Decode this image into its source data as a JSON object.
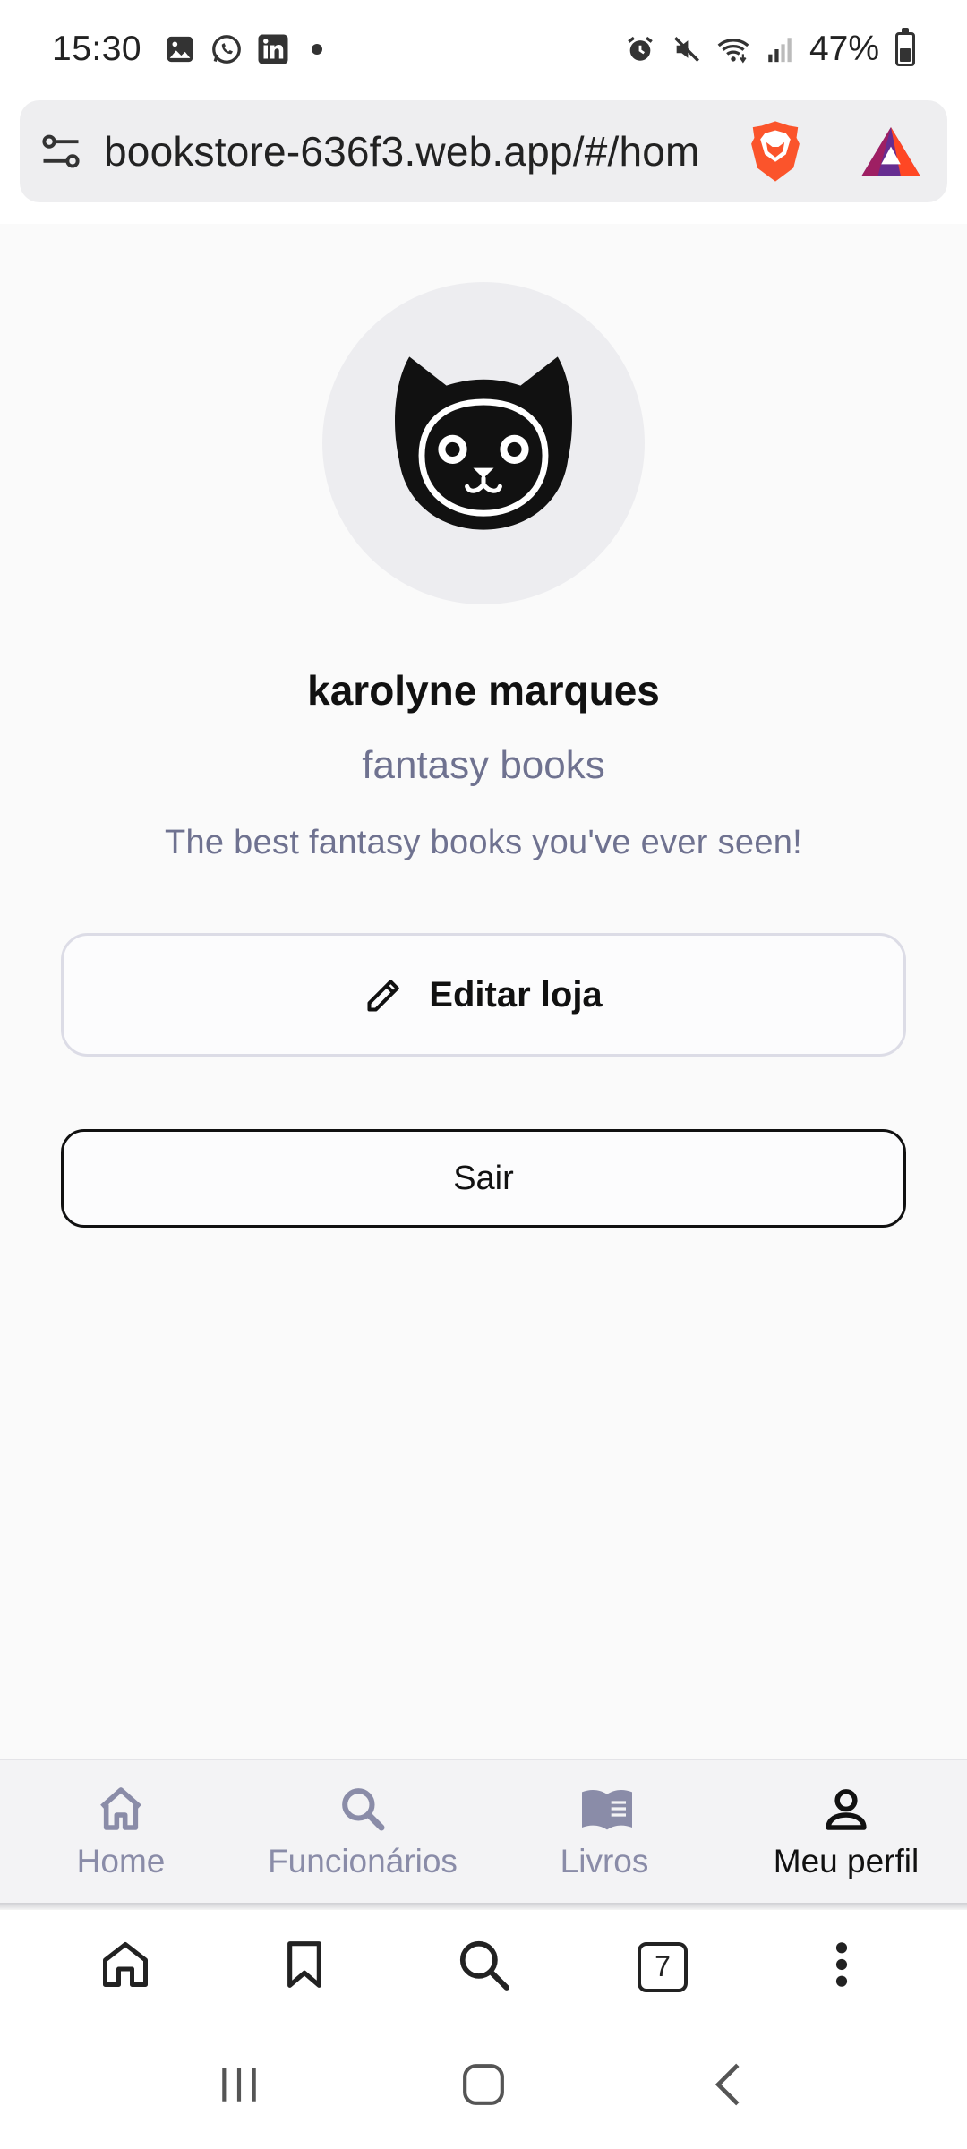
{
  "status_bar": {
    "time": "15:30",
    "battery_percent": "47%",
    "left_icons": [
      "gallery-icon",
      "whatsapp-icon",
      "linkedin-icon",
      "notification-dot"
    ],
    "right_icons": [
      "alarm-icon",
      "mute-icon",
      "wifi-icon",
      "signal-icon",
      "battery-icon"
    ],
    "battery_level": 0.47
  },
  "browser": {
    "url": "bookstore-636f3.web.app/#/hom",
    "tab_count": "7"
  },
  "profile": {
    "owner_name": "karolyne marques",
    "store_name": "fantasy books",
    "store_description": "The best fantasy books you've ever seen!",
    "edit_label": "Editar loja",
    "logout_label": "Sair"
  },
  "app_nav": {
    "items": [
      {
        "label": "Home",
        "icon": "home-icon",
        "active": false
      },
      {
        "label": "Funcionários",
        "icon": "search-icon",
        "active": false
      },
      {
        "label": "Livros",
        "icon": "book-icon",
        "active": false
      },
      {
        "label": "Meu perfil",
        "icon": "person-icon",
        "active": true
      }
    ]
  },
  "colors": {
    "accent_muted": "#6f7290",
    "nav_inactive": "#8a8ca8",
    "avatar_bg": "#ededf0",
    "page_bg": "#fafafa"
  }
}
